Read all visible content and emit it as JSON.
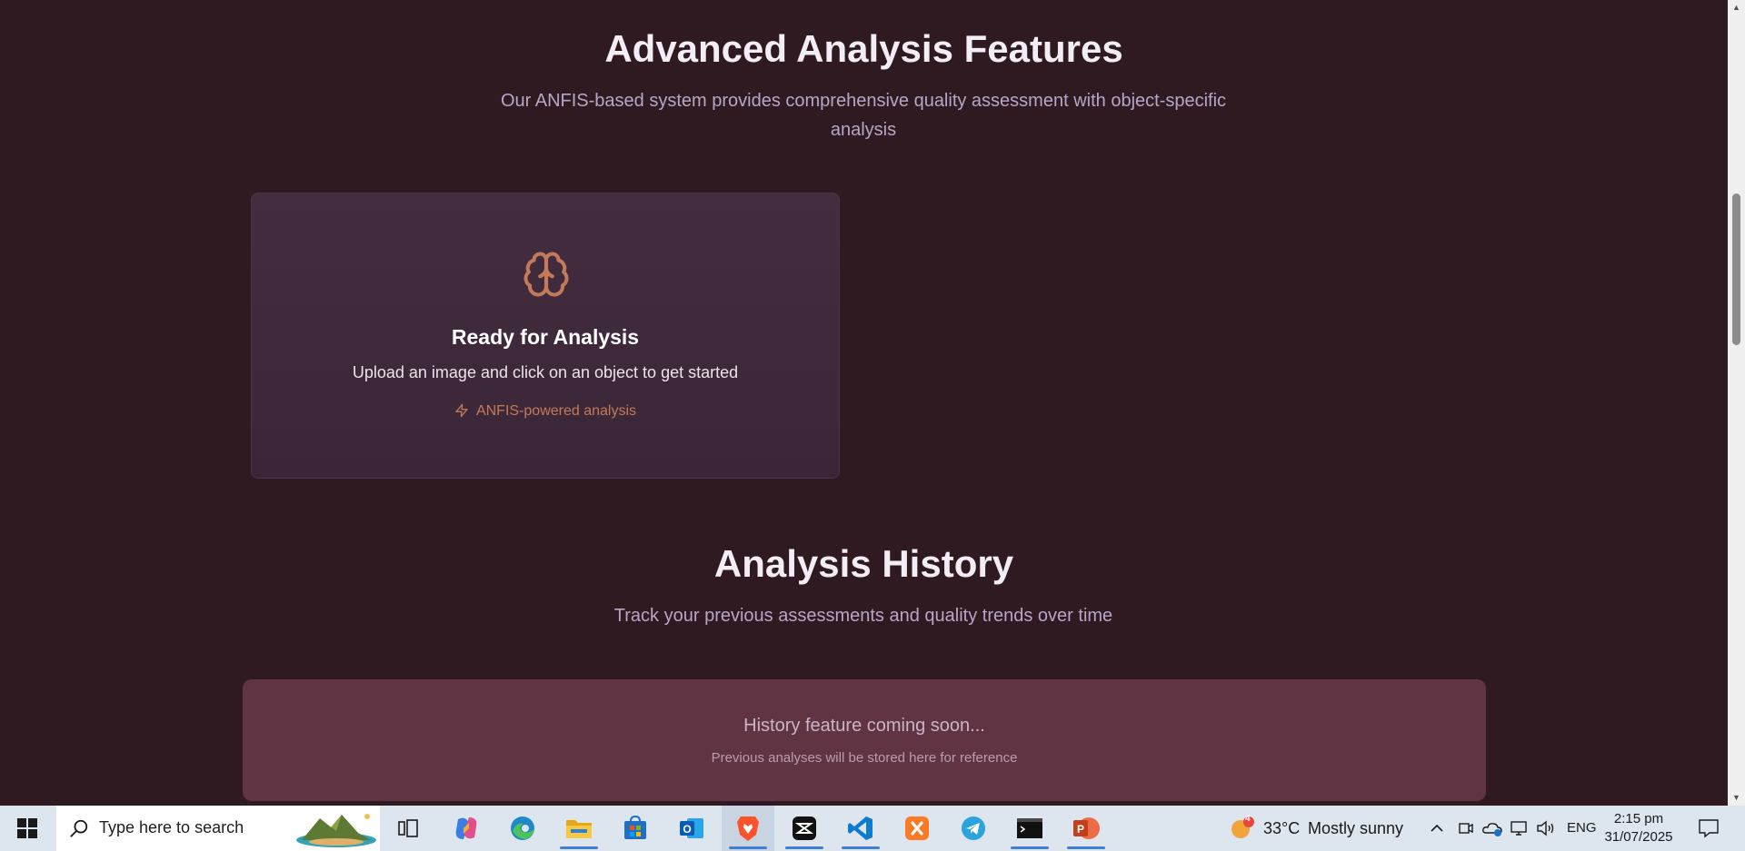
{
  "features": {
    "title": "Advanced Analysis Features",
    "subtitle": "Our ANFIS-based system provides comprehensive quality assessment with object-specific analysis",
    "card": {
      "icon": "brain-icon",
      "title": "Ready for Analysis",
      "description": "Upload an image and click on an object to get started",
      "badge": "ANFIS-powered analysis",
      "badge_icon": "bolt-icon",
      "accent": "#c27a5a"
    }
  },
  "history": {
    "title": "Analysis History",
    "subtitle": "Track your previous assessments and quality trends over time",
    "card_title": "History feature coming soon...",
    "card_sub": "Previous analyses will be stored here for reference"
  },
  "taskbar": {
    "search_placeholder": "Type here to search",
    "apps": [
      "task-view",
      "copilot",
      "edge",
      "file-explorer",
      "microsoft-store",
      "outlook",
      "brave",
      "capcut",
      "vs-code",
      "xampp",
      "telegram",
      "terminal",
      "powerpoint"
    ],
    "weather": {
      "temp": "33°C",
      "condition": "Mostly sunny",
      "badge": "4"
    },
    "language": "ENG",
    "time": "2:15 pm",
    "date": "31/07/2025"
  },
  "colors": {
    "background": "#2e1a20",
    "card": "#432d3f",
    "history_card": "#613443",
    "accent": "#c27a5a"
  }
}
